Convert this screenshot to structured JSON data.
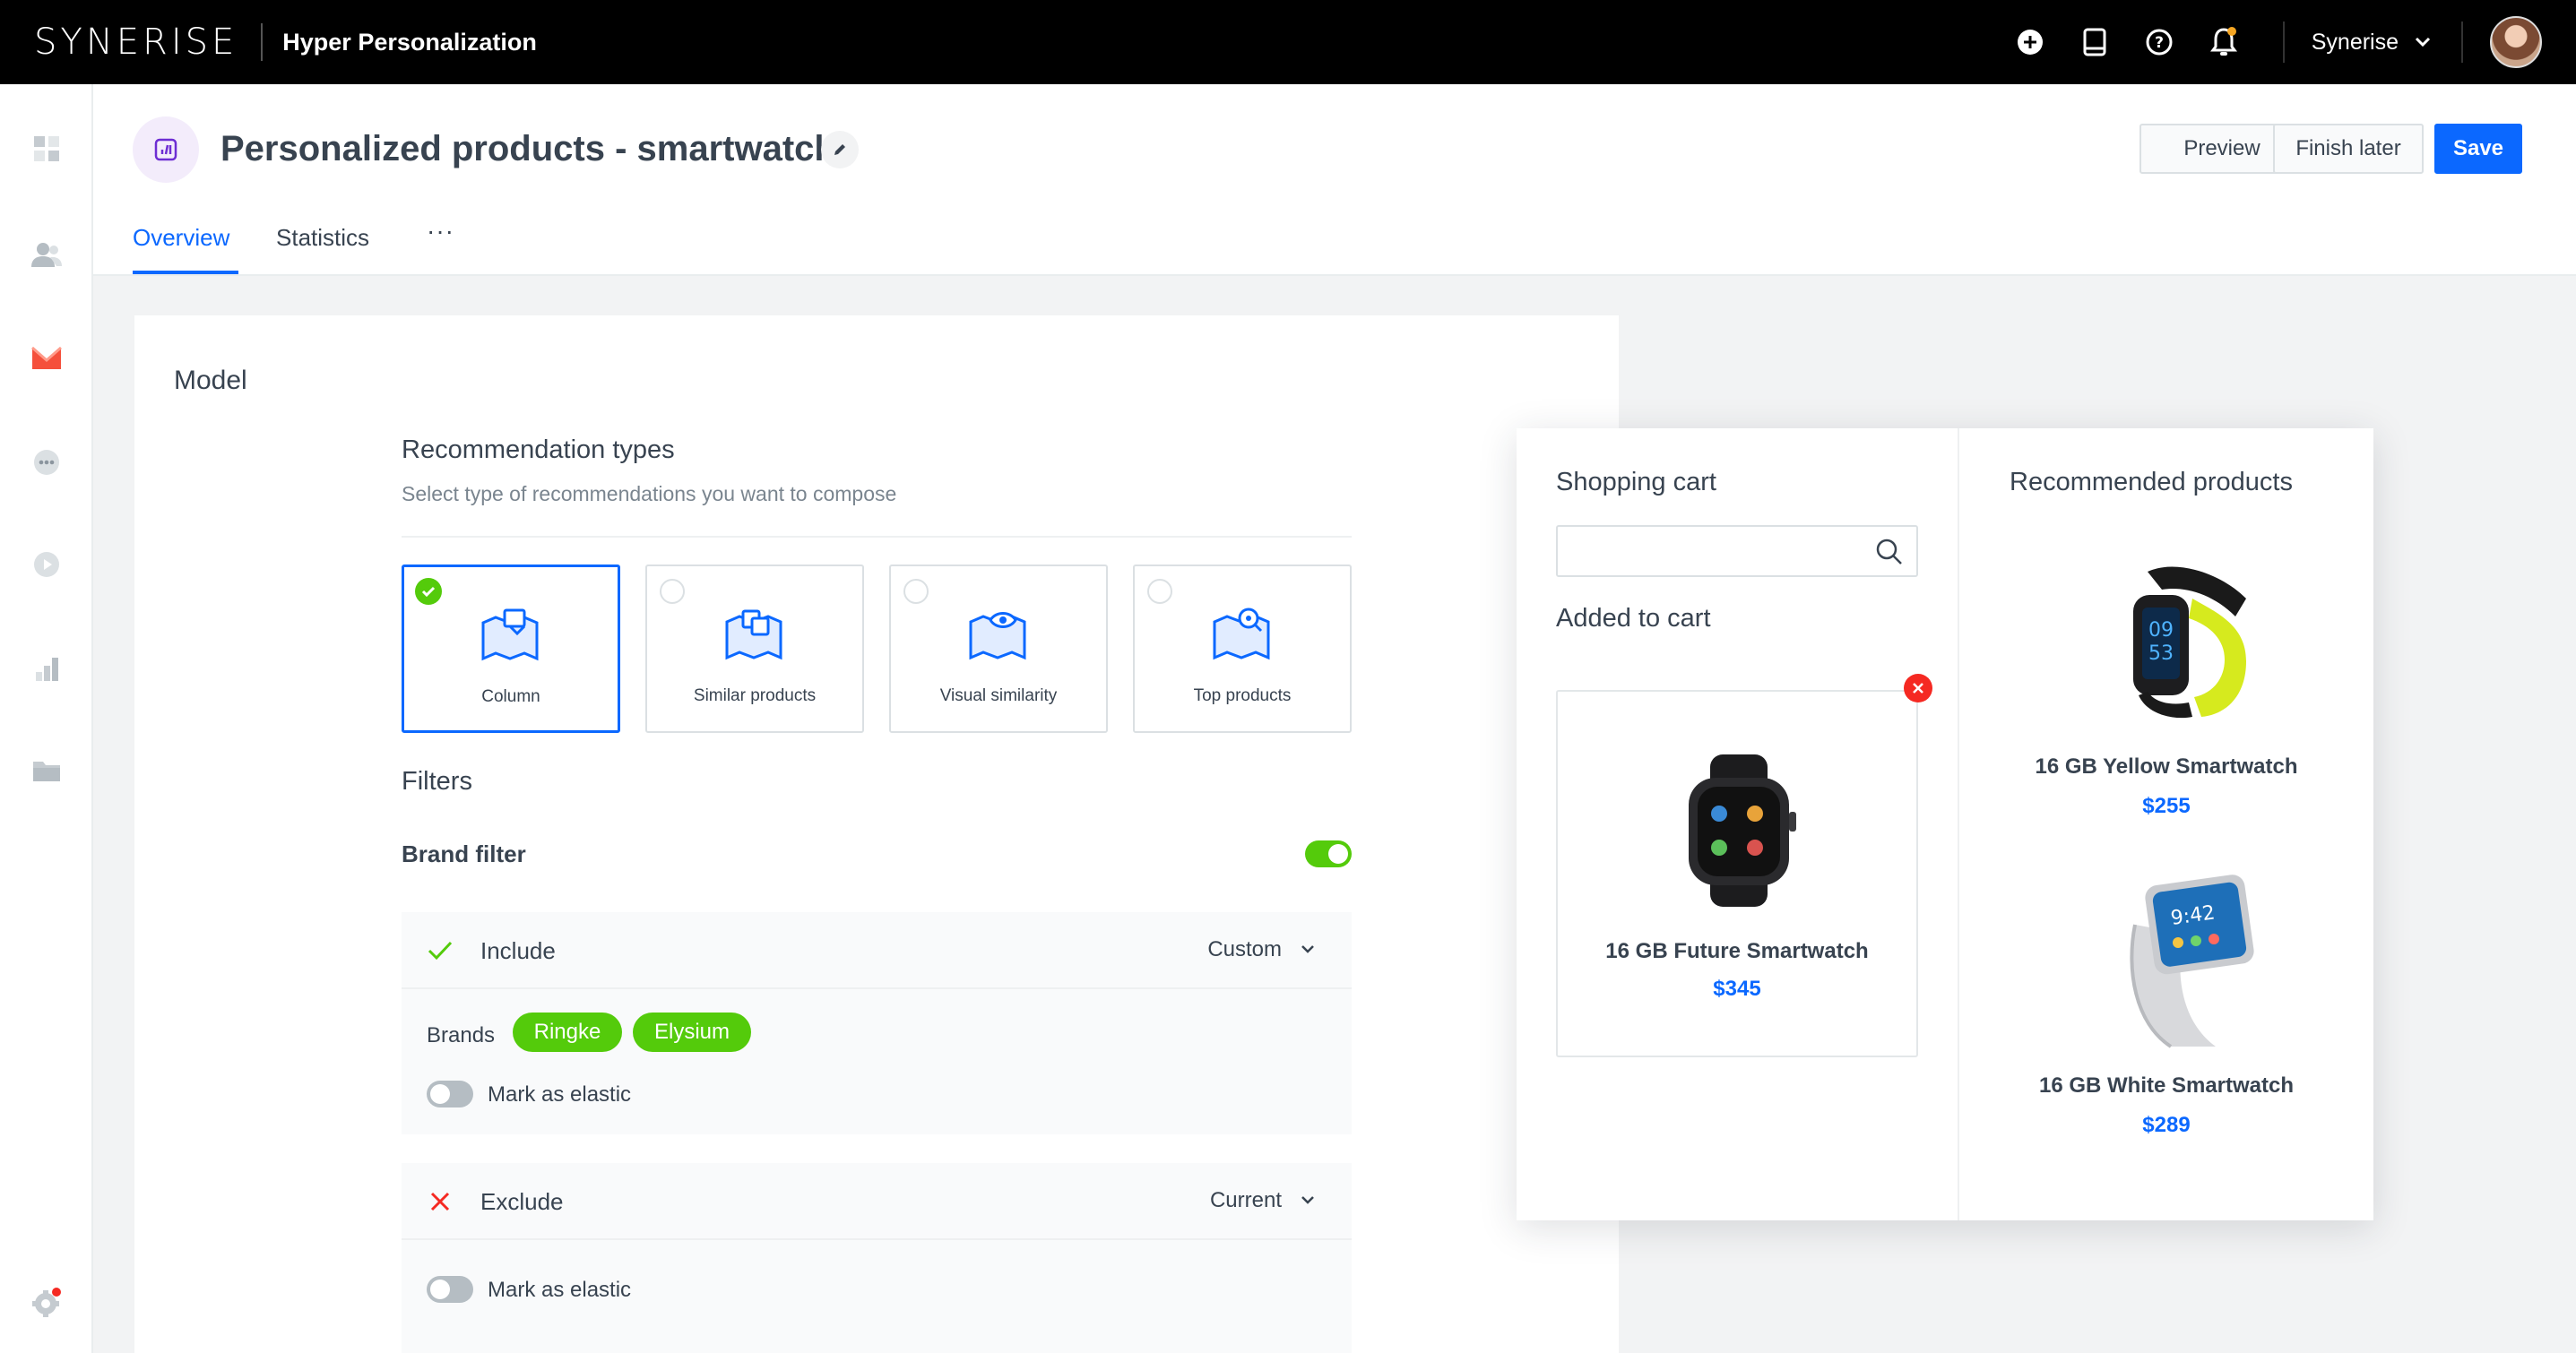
{
  "topbar": {
    "logo": "SYNERISE",
    "app_name": "Hyper Personalization",
    "account_name": "Synerise",
    "icons": [
      "plus-circle-icon",
      "book-icon",
      "help-icon",
      "bell-icon",
      "chevron-down-icon"
    ]
  },
  "sidebar": {
    "icons": [
      "dashboard-icon",
      "users-icon",
      "campaign-icon",
      "chat-icon",
      "play-icon",
      "analytics-icon",
      "folder-icon",
      "settings-icon"
    ]
  },
  "header": {
    "title": "Personalized products - smartwatch",
    "preview_label": "Preview",
    "finish_later_label": "Finish later",
    "save_label": "Save",
    "tabs": [
      {
        "label": "Overview",
        "active": true
      },
      {
        "label": "Statistics",
        "active": false
      }
    ],
    "more_label": "···"
  },
  "model": {
    "title": "Model",
    "recommendation_types": {
      "title": "Recommendation types",
      "subtitle": "Select type of recommendations you want to compose",
      "options": [
        {
          "label": "Column",
          "selected": true
        },
        {
          "label": "Similar products",
          "selected": false
        },
        {
          "label": "Visual similarity",
          "selected": false
        },
        {
          "label": "Top products",
          "selected": false
        }
      ]
    },
    "filters": {
      "title": "Filters",
      "brand_filter_label": "Brand filter",
      "brand_filter_on": true,
      "include": {
        "label": "Include",
        "select": "Custom",
        "brands_label": "Brands",
        "brands": [
          "Ringke",
          "Elysium"
        ],
        "elastic_label": "Mark as elastic"
      },
      "exclude": {
        "label": "Exclude",
        "select": "Current",
        "elastic_label": "Mark as elastic"
      }
    }
  },
  "widget": {
    "cart_title": "Shopping cart",
    "search_placeholder": "",
    "added_title": "Added to cart",
    "cart_item": {
      "name": "16 GB Future Smartwatch",
      "price": "$345"
    },
    "recommended_title": "Recommended products",
    "recommended": [
      {
        "name": "16 GB Yellow Smartwatch",
        "price": "$255"
      },
      {
        "name": "16 GB White Smartwatch",
        "price": "$289"
      }
    ]
  },
  "colors": {
    "accent": "#0b68ff",
    "success": "#54cb0b",
    "danger": "#f52922",
    "topbar": "#000000"
  }
}
